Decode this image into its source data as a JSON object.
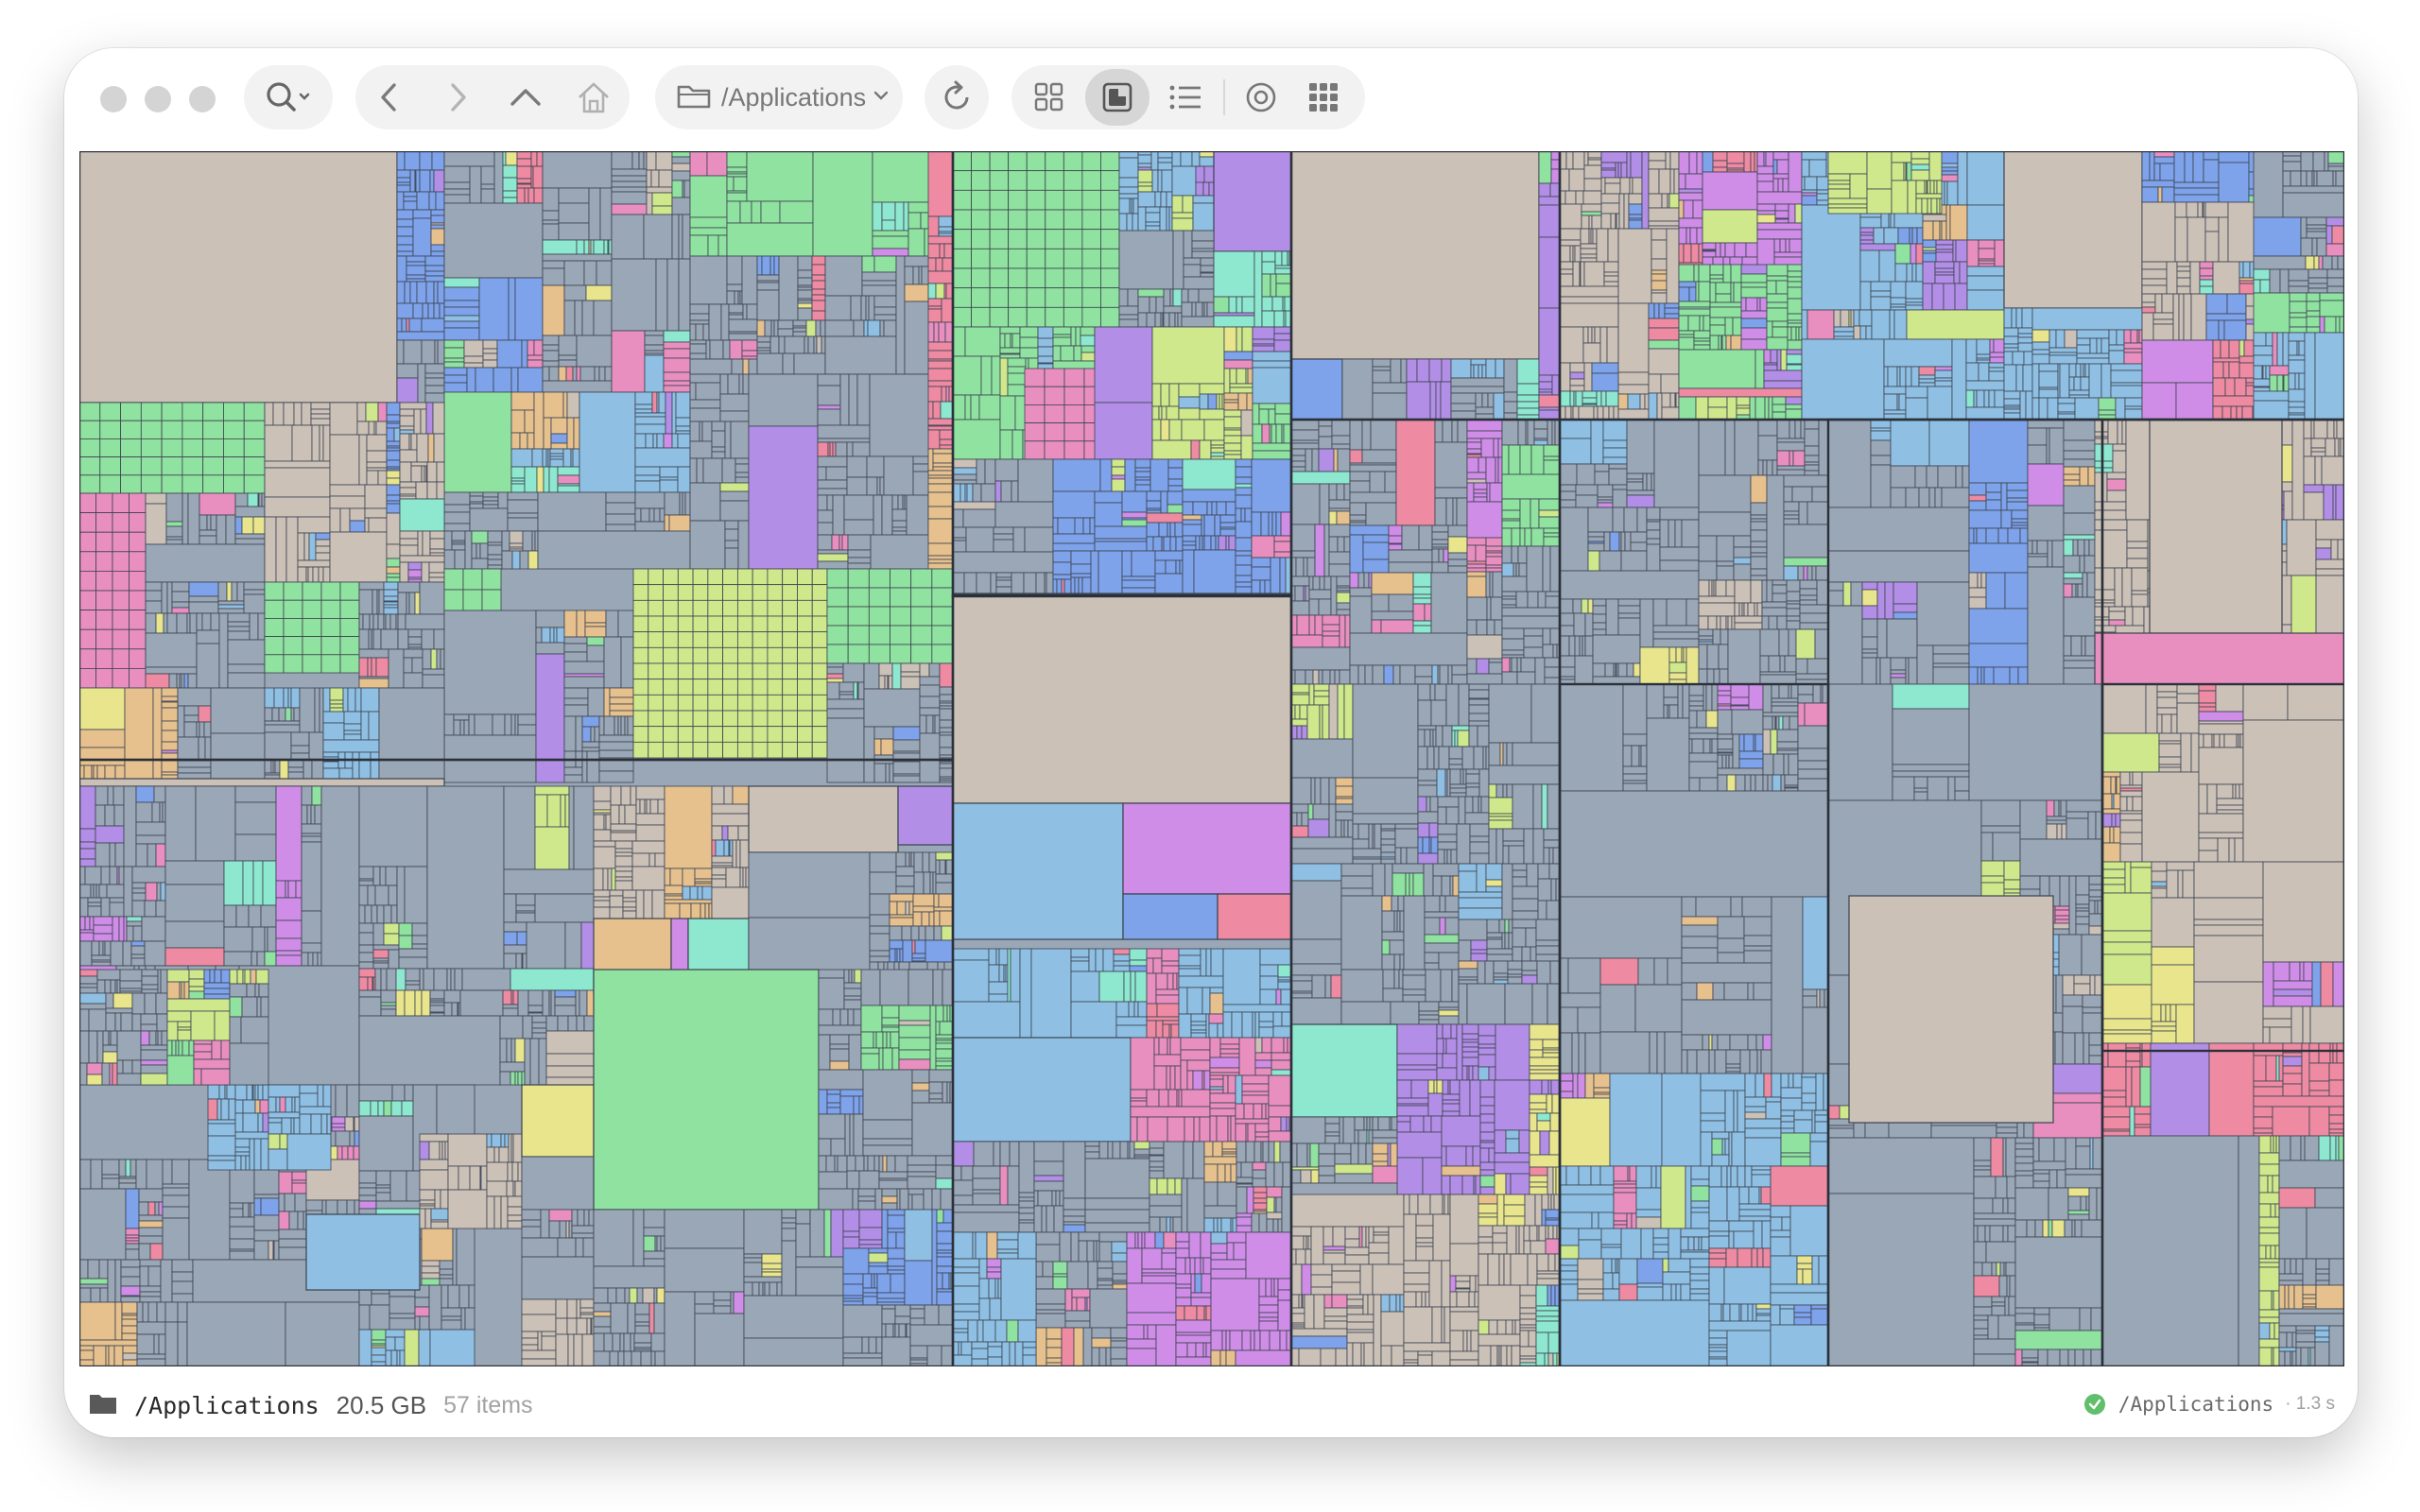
{
  "toolbar": {
    "search_icon": "magnifier-icon",
    "path_label": "/Applications",
    "views": [
      "icon-grid-view",
      "treemap-view",
      "list-view",
      "sunburst-view",
      "apps-view"
    ],
    "active_view": "treemap-view"
  },
  "treemap": {
    "root": "/Applications",
    "palette": {
      "tan": "#cbc1b7",
      "steel": "#9aa7b6",
      "sky": "#8fc0e4",
      "blue": "#7ea3ea",
      "green": "#8fe29f",
      "lime": "#cfe88c",
      "purple": "#b38ee6",
      "violet": "#cf8de7",
      "pink": "#e98fbf",
      "rose": "#ee8aa2",
      "mint": "#8ee7cf",
      "yellow": "#e8e58d",
      "peach": "#e6c18e"
    }
  },
  "status": {
    "path": "/Applications",
    "size": "20.5 GB",
    "items": "57 items",
    "right_path": "/Applications",
    "elapsed": "· 1.3 s"
  }
}
